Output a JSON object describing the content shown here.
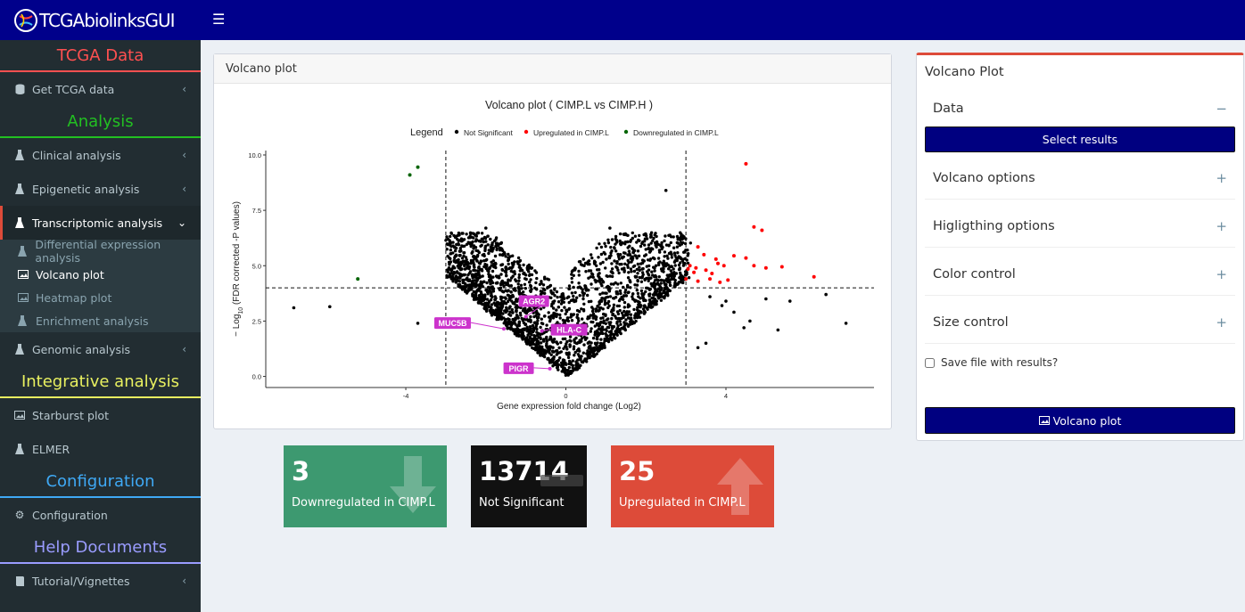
{
  "app": {
    "title": "TCGAbiolinksGUI"
  },
  "sidebar": {
    "sections": {
      "tcga": "TCGA Data",
      "analysis": "Analysis",
      "integrative": "Integrative analysis",
      "configuration": "Configuration",
      "help": "Help Documents"
    },
    "items": {
      "get_tcga": "Get TCGA data",
      "clinical": "Clinical analysis",
      "epigenetic": "Epigenetic analysis",
      "transcriptomic": "Transcriptomic analysis",
      "genomic": "Genomic analysis",
      "starburst": "Starburst plot",
      "elmer": "ELMER",
      "configuration": "Configuration",
      "tutorial": "Tutorial/Vignettes"
    },
    "subitems": {
      "dea": "Differential expression analysis",
      "volcano": "Volcano plot",
      "heatmap": "Heatmap plot",
      "enrichment": "Enrichment analysis"
    }
  },
  "plot_panel": {
    "header": "Volcano plot"
  },
  "chart_data": {
    "type": "scatter",
    "title": "Volcano plot ( CIMP.L vs CIMP.H )",
    "xlabel": "Gene expression fold change (Log2)",
    "ylabel": "−Log10 (FDR corrected -P values)",
    "ylabel_sub": "10",
    "ylabel_pre": "− Log",
    "ylabel_post": " (FDR corrected -P values)",
    "x_ticks": [
      "-4",
      "0",
      "4"
    ],
    "y_ticks": [
      "0.0",
      "2.5",
      "5.0",
      "7.5",
      "10.0"
    ],
    "xlim": [
      -7.5,
      7.7
    ],
    "ylim": [
      -0.5,
      10.2
    ],
    "thresholds": {
      "x": [
        -3,
        3
      ],
      "y": 4
    },
    "legend": {
      "title": "Legend",
      "entries": [
        "Not Significant",
        "Upregulated in CIMP.L",
        "Downregulated in CIMP.L"
      ],
      "placement": "top"
    },
    "colors": {
      "not_significant": "#000000",
      "up": "#ff0000",
      "down": "#006400",
      "label_bg": "#cc33cc"
    },
    "downregulated": [
      [
        -3.9,
        9.1
      ],
      [
        -3.7,
        9.45
      ],
      [
        -5.2,
        4.4
      ]
    ],
    "upregulated": [
      [
        4.5,
        9.6
      ],
      [
        4.7,
        6.75
      ],
      [
        4.9,
        6.6
      ],
      [
        3.3,
        5.85
      ],
      [
        3.45,
        5.5
      ],
      [
        3.75,
        5.3
      ],
      [
        4.2,
        5.45
      ],
      [
        4.5,
        5.35
      ],
      [
        4.7,
        5.0
      ],
      [
        5.0,
        4.9
      ],
      [
        5.4,
        4.95
      ],
      [
        3.1,
        5.0
      ],
      [
        3.25,
        4.9
      ],
      [
        3.5,
        4.8
      ],
      [
        3.65,
        4.65
      ],
      [
        3.8,
        5.1
      ],
      [
        3.95,
        5.0
      ],
      [
        3.0,
        4.4
      ],
      [
        3.3,
        4.3
      ],
      [
        3.6,
        4.4
      ],
      [
        3.85,
        4.25
      ],
      [
        4.05,
        4.35
      ],
      [
        3.2,
        4.7
      ],
      [
        6.2,
        4.5
      ],
      [
        3.05,
        4.85
      ]
    ],
    "labeled_genes": [
      {
        "name": "AGR2",
        "x": -1.0,
        "y": 2.7
      },
      {
        "name": "MUC5B",
        "x": -1.55,
        "y": 2.15
      },
      {
        "name": "HLA-C",
        "x": -0.6,
        "y": 2.05
      },
      {
        "name": "PIGR",
        "x": -0.4,
        "y": 0.35
      }
    ],
    "not_significant_extra": [
      [
        -6.8,
        3.1
      ],
      [
        -5.9,
        3.15
      ],
      [
        -3.7,
        2.4
      ],
      [
        2.5,
        8.4
      ],
      [
        1.1,
        6.7
      ],
      [
        -2.0,
        6.7
      ],
      [
        -2.1,
        6.2
      ],
      [
        6.5,
        3.7
      ],
      [
        7.0,
        2.4
      ],
      [
        5.6,
        3.4
      ],
      [
        5.0,
        3.5
      ],
      [
        5.3,
        2.1
      ],
      [
        4.45,
        2.2
      ],
      [
        4.6,
        2.5
      ],
      [
        3.5,
        1.5
      ],
      [
        3.3,
        1.3
      ],
      [
        3.9,
        3.2
      ],
      [
        4.2,
        2.9
      ],
      [
        3.6,
        3.6
      ],
      [
        4.0,
        3.4
      ]
    ],
    "not_significant_count": 13714
  },
  "right_panel": {
    "title": "Volcano Plot",
    "data_section": "Data",
    "select_results": "Select results",
    "volcano_options": "Volcano options",
    "highlighting_options": "Higligthing options",
    "color_control": "Color control",
    "size_control": "Size control",
    "save_label": "Save file with results?",
    "plot_button": "Volcano plot"
  },
  "value_boxes": [
    {
      "value": "3",
      "label": "Downregulated in CIMP.L",
      "color": "#3d9970"
    },
    {
      "value": "13714",
      "label": "Not Significant",
      "color": "#111111"
    },
    {
      "value": "25",
      "label": "Upregulated in CIMP.L",
      "color": "#dd4b39"
    }
  ]
}
